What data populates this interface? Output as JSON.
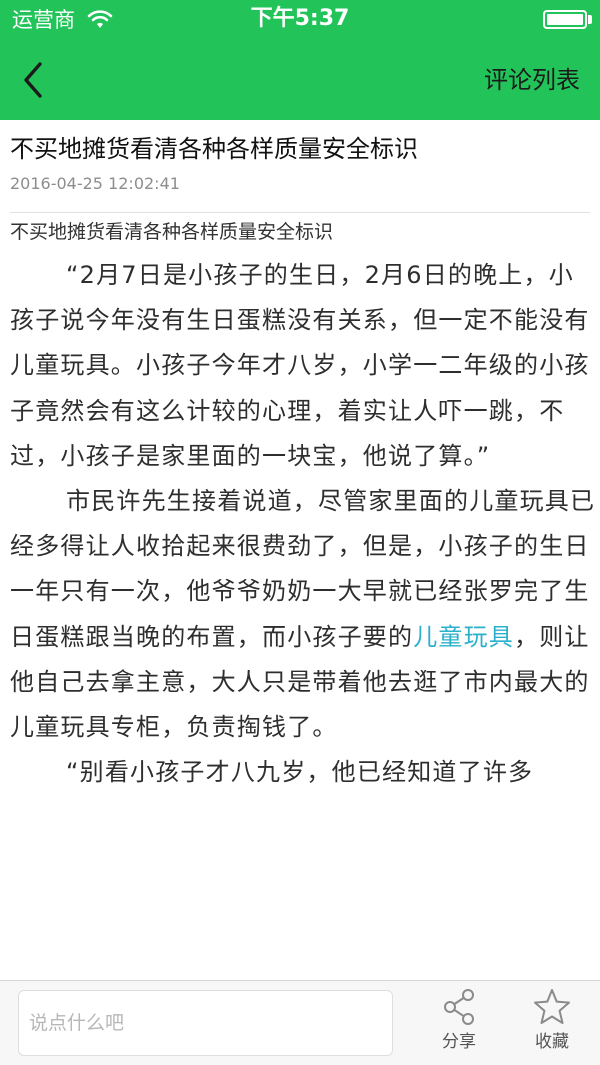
{
  "status_bar": {
    "carrier": "运营商",
    "time": "下午5:37"
  },
  "nav": {
    "right_label": "评论列表"
  },
  "article": {
    "title": "不买地摊货看清各种各样质量安全标识",
    "date": "2016-04-25 12:02:41",
    "subtitle": "不买地摊货看清各种各样质量安全标识",
    "p1": "“2月7日是小孩子的生日，2月6日的晚上，小孩子说今年没有生日蛋糕没有关系，但一定不能没有儿童玩具。小孩子今年才八岁，小学一二年级的小孩子竟然会有这么计较的心理，着实让人吓一跳，不过，小孩子是家里面的一块宝，他说了算。”",
    "p2_before": "市民许先生接着说道，尽管家里面的儿童玩具已经多得让人收拾起来很费劲了，但是，小孩子的生日一年只有一次，他爷爷奶奶一大早就已经张罗完了生日蛋糕跟当晚的布置，而小孩子要的",
    "p2_link": "儿童玩具",
    "p2_after": "，则让他自己去拿主意，大人只是带着他去逛了市内最大的儿童玩具专柜，负责掏钱了。",
    "p3": "“别看小孩子才八九岁，他已经知道了许多"
  },
  "bottom_bar": {
    "comment_placeholder": "说点什么吧",
    "share_label": "分享",
    "favorite_label": "收藏"
  },
  "colors": {
    "brand": "#22c45a",
    "link": "#2bb0cc"
  },
  "icons": [
    "wifi-icon",
    "battery-icon",
    "back-arrow-icon",
    "share-icon",
    "star-icon"
  ]
}
